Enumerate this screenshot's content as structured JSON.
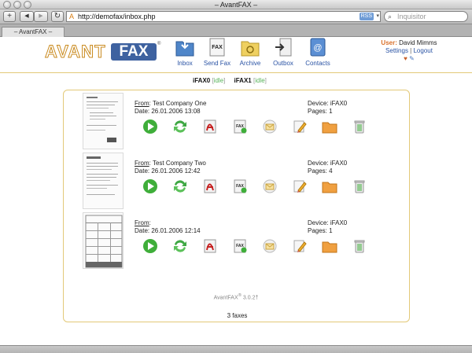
{
  "window": {
    "title": "– AvantFAX –"
  },
  "toolbar": {
    "add_label": "+",
    "back_label": "◀",
    "forward_label": "▶",
    "reload_label": "↻",
    "url": "http://demofax/inbox.php",
    "rss_label": "RSS",
    "search_placeholder": "Inquisitor"
  },
  "tabs": [
    {
      "label": "– AvantFAX –"
    }
  ],
  "logo": {
    "avant": "AVANT",
    "fax": "FAX",
    "reg": "®"
  },
  "nav": [
    {
      "label": "Inbox",
      "icon": "inbox-folder-icon"
    },
    {
      "label": "Send Fax",
      "icon": "send-fax-icon"
    },
    {
      "label": "Archive",
      "icon": "archive-folder-icon"
    },
    {
      "label": "Outbox",
      "icon": "outbox-icon"
    },
    {
      "label": "Contacts",
      "icon": "contacts-book-icon"
    }
  ],
  "user": {
    "label": "User:",
    "name": "David Mimms",
    "settings": "Settings",
    "separator": "|",
    "logout": "Logout"
  },
  "modems": [
    {
      "name": "iFAX0",
      "status": "idle"
    },
    {
      "name": "iFAX1",
      "status": "idle"
    }
  ],
  "faxes": [
    {
      "from_label": "From",
      "from": ": Test Company One",
      "date": "Date: 26.01.2006 13:08",
      "device": "Device: iFAX0",
      "pages": "Pages: 1"
    },
    {
      "from_label": "From",
      "from": ": Test Company Two",
      "date": "Date: 26.01.2006 12:42",
      "device": "Device: iFAX0",
      "pages": "Pages: 4"
    },
    {
      "from_label": "From",
      "from": ":",
      "date": "Date: 26.01.2006 12:14",
      "device": "Device: iFAX0",
      "pages": "Pages: 1"
    }
  ],
  "actions": [
    "play-arrow-icon",
    "forward-arrows-icon",
    "pdf-icon",
    "fax-to-email-icon",
    "email-icon",
    "edit-pencil-icon",
    "archive-folder-icon",
    "trash-can-icon"
  ],
  "summary": {
    "count": "3 faxes"
  },
  "footer": {
    "brand": "AvantFAX",
    "reg": "®",
    "version": "3.0.2†"
  },
  "colors": {
    "accent_orange": "#d9702a",
    "link_blue": "#2a53a4",
    "status_green": "#58b35a",
    "panel_border": "#e3c978",
    "logo_blue": "#3e62a0"
  }
}
